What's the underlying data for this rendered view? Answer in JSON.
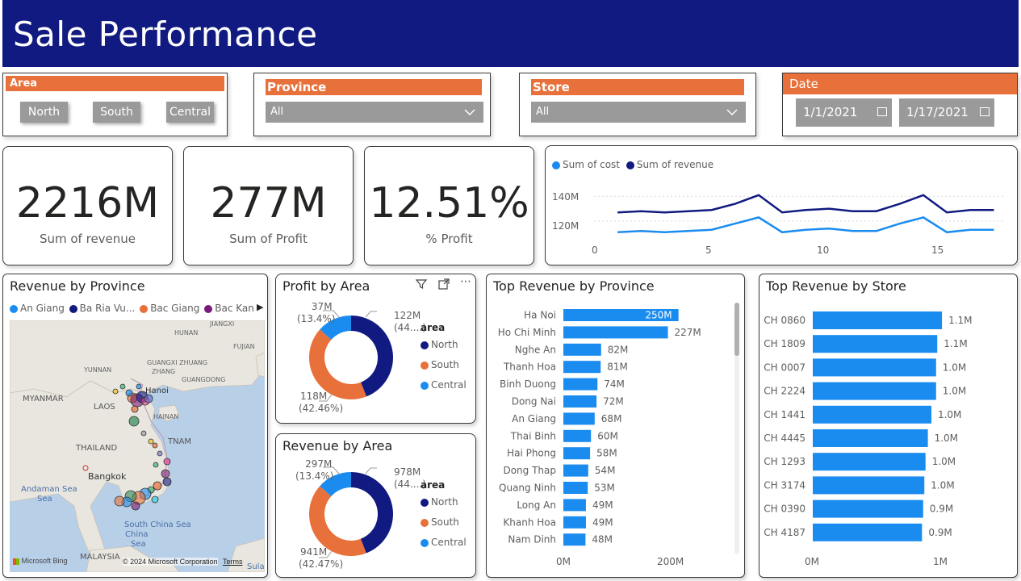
{
  "header": {
    "title": "Sale Performance"
  },
  "slicers": {
    "area": {
      "title": "Area",
      "options": [
        "North",
        "South",
        "Central"
      ]
    },
    "province": {
      "title": "Province",
      "value": "All"
    },
    "store": {
      "title": "Store",
      "value": "All"
    },
    "date": {
      "title": "Date",
      "start": "1/1/2021",
      "end": "1/17/2021"
    }
  },
  "kpis": [
    {
      "value": "2216M",
      "label": "Sum of revenue"
    },
    {
      "value": "277M",
      "label": "Sum of Profit"
    },
    {
      "value": "12.51%",
      "label": "% Profit"
    }
  ],
  "colors": {
    "navy": "#101a80",
    "blue": "#1a8cf0",
    "orange": "#e8703a",
    "bar": "#1a8cf0"
  },
  "line_chart": {
    "legend": [
      "Sum of cost",
      "Sum of revenue"
    ],
    "y_ticks": [
      "140M",
      "120M"
    ],
    "x_ticks": [
      "0",
      "5",
      "10",
      "15"
    ]
  },
  "map": {
    "title": "Revenue by Province",
    "legend": [
      "An Giang",
      "Ba Ria Vu...",
      "Bac Giang",
      "Bac Kan"
    ],
    "labels": [
      "MYANMAR",
      "LAOS",
      "THAILAND",
      "Bangkok",
      "Andaman Sea",
      "South China Sea",
      "MALAYSIA",
      "YUNNAN",
      "GUANGXI ZHUANG",
      "GUANGDONG",
      "HUNAN",
      "FUJIAN",
      "JIANGXI",
      "HAINAN",
      "Hanoi",
      "TNAM"
    ],
    "footer": "© 2024 Microsoft Corporation",
    "terms": "Terms",
    "bing": "Microsoft Bing",
    "sula": "Sula"
  },
  "profit_by_area": {
    "title": "Profit by Area",
    "legend_title": "area",
    "legend": [
      "North",
      "South",
      "Central"
    ],
    "labels": {
      "north_value": "122M",
      "north_pct": "(44....)",
      "south_value": "118M",
      "south_pct": "(42.46%)",
      "central_value": "37M",
      "central_pct": "(13.4%)"
    }
  },
  "revenue_by_area": {
    "title": "Revenue by Area",
    "legend_title": "area",
    "legend": [
      "North",
      "South",
      "Central"
    ],
    "labels": {
      "north_value": "978M",
      "north_pct": "(44....)",
      "south_value": "941M",
      "south_pct": "(42.47%)",
      "central_value": "297M",
      "central_pct": "(13.4%)"
    }
  },
  "top_province": {
    "title": "Top Revenue by Province",
    "x_ticks": [
      "0M",
      "200M"
    ]
  },
  "top_store": {
    "title": "Top Revenue by Store",
    "x_ticks": [
      "0M",
      "1M"
    ]
  },
  "chart_data": [
    {
      "type": "line",
      "title": "",
      "x": [
        1,
        2,
        3,
        4,
        5,
        6,
        7,
        8,
        9,
        10,
        11,
        12,
        13,
        14,
        15,
        16,
        17
      ],
      "series": [
        {
          "name": "Sum of cost",
          "values": [
            111,
            112,
            111,
            112,
            113,
            118,
            123,
            111,
            113,
            114,
            112,
            112,
            118,
            123,
            111,
            113,
            113
          ]
        },
        {
          "name": "Sum of revenue",
          "values": [
            127,
            128,
            127,
            128,
            129,
            134,
            141,
            127,
            129,
            130,
            128,
            128,
            134,
            141,
            127,
            129,
            129
          ]
        }
      ],
      "ylim": [
        105,
        150
      ],
      "xlim": [
        0,
        17.5
      ]
    },
    {
      "type": "pie",
      "title": "Profit by Area",
      "categories": [
        "North",
        "South",
        "Central"
      ],
      "values": [
        122,
        118,
        37
      ]
    },
    {
      "type": "pie",
      "title": "Revenue by Area",
      "categories": [
        "North",
        "South",
        "Central"
      ],
      "values": [
        978,
        941,
        297
      ]
    },
    {
      "type": "bar",
      "title": "Top Revenue by Province",
      "categories": [
        "Ha Noi",
        "Ho Chi Minh",
        "Nghe An",
        "Thanh Hoa",
        "Binh Duong",
        "Dong Nai",
        "An Giang",
        "Thai Binh",
        "Hai Phong",
        "Dong Thap",
        "Quang Ninh",
        "Long An",
        "Khanh Hoa",
        "Nam Dinh"
      ],
      "values": [
        250,
        227,
        82,
        81,
        74,
        72,
        68,
        60,
        58,
        54,
        53,
        49,
        49,
        48
      ],
      "labels": [
        "250M",
        "227M",
        "82M",
        "81M",
        "74M",
        "72M",
        "68M",
        "60M",
        "58M",
        "54M",
        "53M",
        "49M",
        "49M",
        "48M"
      ],
      "xlim": [
        0,
        340
      ]
    },
    {
      "type": "bar",
      "title": "Top Revenue by Store",
      "categories": [
        "CH 0860",
        "CH 1809",
        "CH 0007",
        "CH 2224",
        "CH 1441",
        "CH 4445",
        "CH 1293",
        "CH 3174",
        "CH 0390",
        "CH 4187"
      ],
      "values": [
        1.1,
        1.06,
        1.05,
        1.05,
        1.01,
        0.98,
        0.96,
        0.95,
        0.94,
        0.93
      ],
      "labels": [
        "1.1M",
        "1.1M",
        "1.0M",
        "1.0M",
        "1.0M",
        "1.0M",
        "1.0M",
        "1.0M",
        "0.9M",
        "0.9M"
      ],
      "xlim": [
        0,
        1.45
      ]
    }
  ]
}
